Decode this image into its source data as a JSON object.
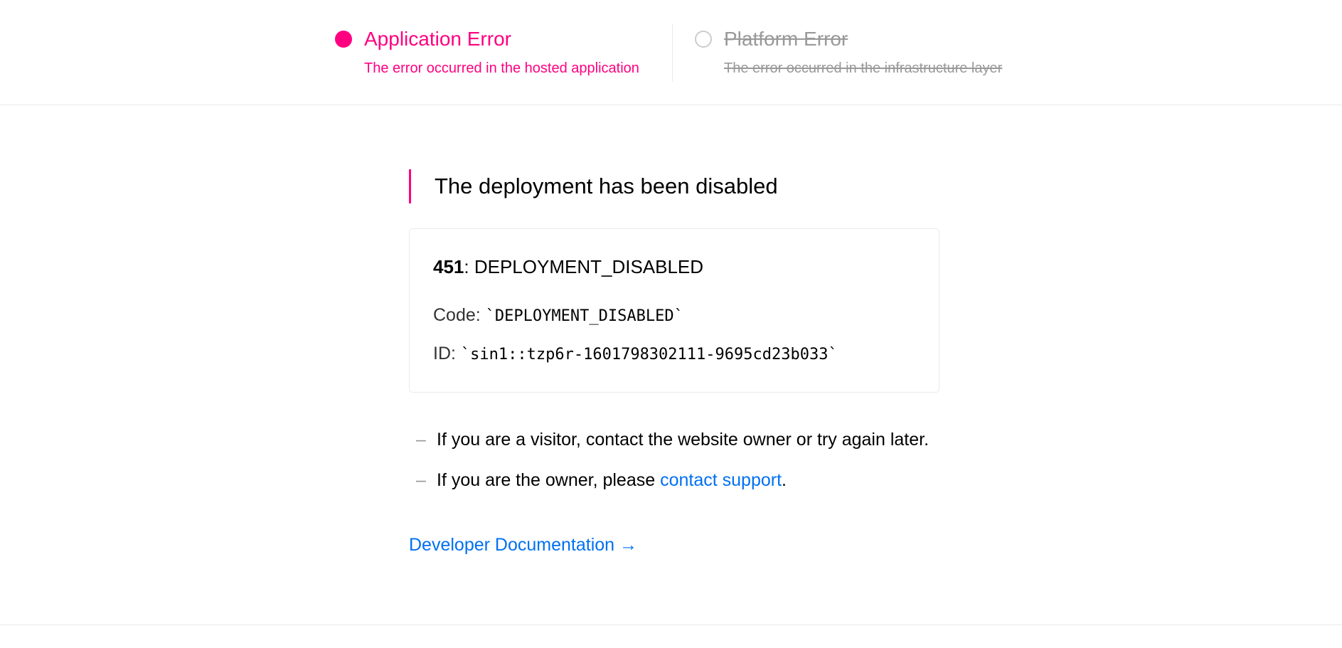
{
  "header": {
    "application_error": {
      "title": "Application Error",
      "subtitle": "The error occurred in the hosted application",
      "selected": true
    },
    "platform_error": {
      "title": "Platform Error",
      "subtitle": "The error occurred in the infrastructure layer",
      "selected": false
    }
  },
  "main": {
    "heading": "The deployment has been disabled",
    "card": {
      "status_code": "451",
      "status_text": ": DEPLOYMENT_DISABLED",
      "code_label": "Code:",
      "code_value": "`DEPLOYMENT_DISABLED`",
      "id_label": "ID:",
      "id_value": "`sin1::tzp6r-1601798302111-9695cd23b033`"
    },
    "bullets": {
      "dash": "–",
      "visitor_text": "If you are a visitor, contact the website owner or try again later.",
      "owner_text_before": "If you are the owner, please ",
      "owner_link": "contact support",
      "owner_text_after": "."
    },
    "docs_link": "Developer Documentation →"
  },
  "colors": {
    "accent": "#ff0080",
    "link": "#0070f3",
    "muted": "#999999",
    "border": "#eaeaea"
  }
}
